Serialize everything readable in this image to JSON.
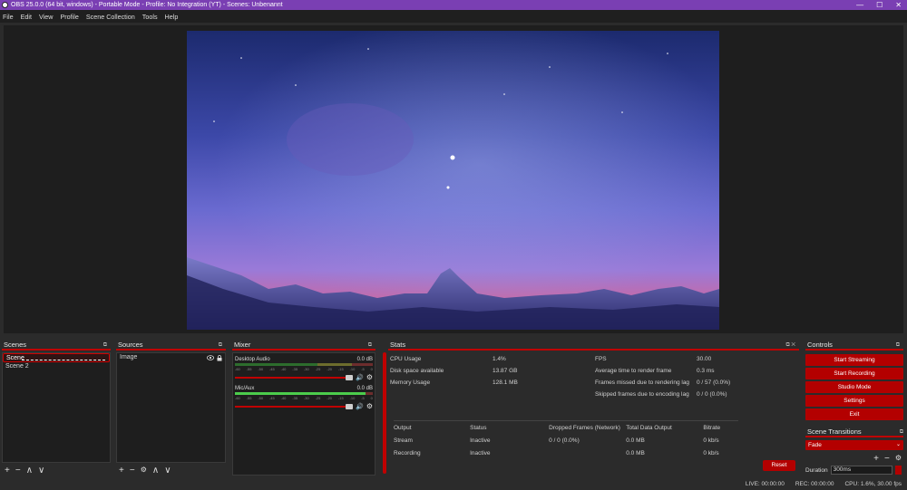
{
  "window": {
    "title": "OBS 25.0.0 (64 bit, windows) - Portable Mode - Profile: No Integration (YT) - Scenes: Unbenannt",
    "controls": [
      "—",
      "☐",
      "✕"
    ]
  },
  "menu": [
    "File",
    "Edit",
    "View",
    "Profile",
    "Scene Collection",
    "Tools",
    "Help"
  ],
  "scenes": {
    "title": "Scenes",
    "items": [
      "Scene",
      "Scene 2"
    ],
    "selected_index": 0,
    "toolbar": [
      "+",
      "−",
      "∧",
      "∨"
    ]
  },
  "sources": {
    "title": "Sources",
    "items": [
      "Image"
    ],
    "toolbar": [
      "+",
      "−",
      "⚙",
      "∧",
      "∨"
    ]
  },
  "mixer": {
    "title": "Mixer",
    "channels": [
      {
        "name": "Desktop Audio",
        "db": "0.0 dB",
        "level": 0.0
      },
      {
        "name": "Mic/Aux",
        "db": "0.0 dB",
        "level": 0.95
      }
    ],
    "ticks": [
      "-60",
      "-55",
      "-50",
      "-45",
      "-40",
      "-35",
      "-30",
      "-25",
      "-20",
      "-15",
      "-10",
      "-5",
      "0"
    ]
  },
  "stats": {
    "title": "Stats",
    "left": [
      {
        "label": "CPU Usage",
        "value": "1.4%"
      },
      {
        "label": "Disk space available",
        "value": "13.87 GB"
      },
      {
        "label": "Memory Usage",
        "value": "128.1 MB"
      }
    ],
    "right": [
      {
        "label": "FPS",
        "value": "30.00"
      },
      {
        "label": "Average time to render frame",
        "value": "0.3 ms"
      },
      {
        "label": "Frames missed due to rendering lag",
        "value": "0 / 57 (0.0%)"
      },
      {
        "label": "Skipped frames due to encoding lag",
        "value": "0 / 0 (0.0%)"
      }
    ],
    "outputs_header": [
      "Output",
      "Status",
      "Dropped Frames (Network)",
      "Total Data Output",
      "Bitrate"
    ],
    "outputs": [
      [
        "Stream",
        "Inactive",
        "0 / 0 (0.0%)",
        "0.0 MB",
        "0 kb/s"
      ],
      [
        "Recording",
        "Inactive",
        "",
        "0.0 MB",
        "0 kb/s"
      ]
    ],
    "reset_label": "Reset"
  },
  "controls": {
    "title": "Controls",
    "buttons": [
      "Start Streaming",
      "Start Recording",
      "Studio Mode",
      "Settings",
      "Exit"
    ]
  },
  "transitions": {
    "title": "Scene Transitions",
    "selected": "Fade",
    "duration_label": "Duration",
    "duration_value": "300ms"
  },
  "status": {
    "live": "LIVE: 00:00:00",
    "rec": "REC: 00:00:00",
    "cpu": "CPU: 1.6%, 30.00 fps"
  },
  "colors": {
    "accent": "#b30000",
    "titlebar": "#7a3fb3",
    "background": "#2b2b2b"
  }
}
